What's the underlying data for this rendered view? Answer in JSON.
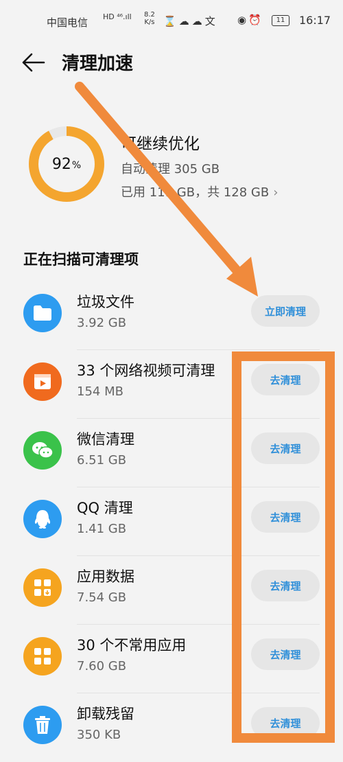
{
  "status_bar": {
    "carrier": "中国电信",
    "network": "HD ⁴⁶.ıll",
    "speed_value": "8.2",
    "speed_unit": "K/s",
    "battery": "11",
    "time": "16:17"
  },
  "header": {
    "title": "清理加速"
  },
  "summary": {
    "percent": "92",
    "percent_sign": "%",
    "percent_value": 0.92,
    "title": "可继续优化",
    "auto_clean": "自动清理 305 GB",
    "usage": "已用 119 GB，共 128 GB",
    "ring_color": "#f4a52f",
    "ring_track_color": "#e8e8e8"
  },
  "section": {
    "title": "正在扫描可清理项"
  },
  "items": [
    {
      "name": "垃圾文件",
      "size": "3.92 GB",
      "action": "立即清理",
      "icon": "folder-icon",
      "color": "#2d9cf0"
    },
    {
      "name": "33 个网络视频可清理",
      "size": "154 MB",
      "action": "去清理",
      "icon": "video-icon",
      "color": "#f06a1e"
    },
    {
      "name": "微信清理",
      "size": "6.51 GB",
      "action": "去清理",
      "icon": "wechat-icon",
      "color": "#3ac24a"
    },
    {
      "name": "QQ 清理",
      "size": "1.41 GB",
      "action": "去清理",
      "icon": "qq-icon",
      "color": "#2d9cf0"
    },
    {
      "name": "应用数据",
      "size": "7.54 GB",
      "action": "去清理",
      "icon": "app-data-icon",
      "color": "#f5a41f"
    },
    {
      "name": "30 个不常用应用",
      "size": "7.60 GB",
      "action": "去清理",
      "icon": "apps-grid-icon",
      "color": "#f5a41f"
    },
    {
      "name": "卸载残留",
      "size": "350 KB",
      "action": "去清理",
      "icon": "trash-icon",
      "color": "#2d9cf0"
    }
  ],
  "annotation": {
    "color": "#f08a3c"
  }
}
